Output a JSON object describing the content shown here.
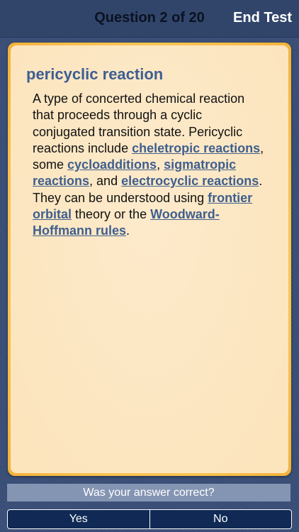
{
  "header": {
    "title": "Question 2 of 20",
    "end_test_label": "End Test"
  },
  "card": {
    "term": "pericyclic reaction",
    "definition": [
      {
        "text": "A type of concerted chemical reaction that proceeds through a cyclic conjugated transition state. Pericyclic reactions include "
      },
      {
        "text": "cheletropic reactions",
        "link": true
      },
      {
        "text": ", some "
      },
      {
        "text": "cycloadditions",
        "link": true
      },
      {
        "text": ", "
      },
      {
        "text": "sigmatropic reactions",
        "link": true
      },
      {
        "text": ", and "
      },
      {
        "text": "electrocyclic reactions",
        "link": true
      },
      {
        "text": ". They can be understood using "
      },
      {
        "text": "frontier orbital",
        "link": true
      },
      {
        "text": " theory or the "
      },
      {
        "text": "Woodward-Hoffmann rules",
        "link": true
      },
      {
        "text": "."
      }
    ]
  },
  "prompt": {
    "question": "Was your answer correct?"
  },
  "answers": {
    "yes_label": "Yes",
    "no_label": "No"
  },
  "colors": {
    "background": "#3a4f78",
    "card_border": "#f8c14e",
    "card_fill": "#fde7c0",
    "term": "#3e5e92",
    "link": "#3f5f8e",
    "question_bar": "#8495b3",
    "answer_bar": "#102a55"
  }
}
